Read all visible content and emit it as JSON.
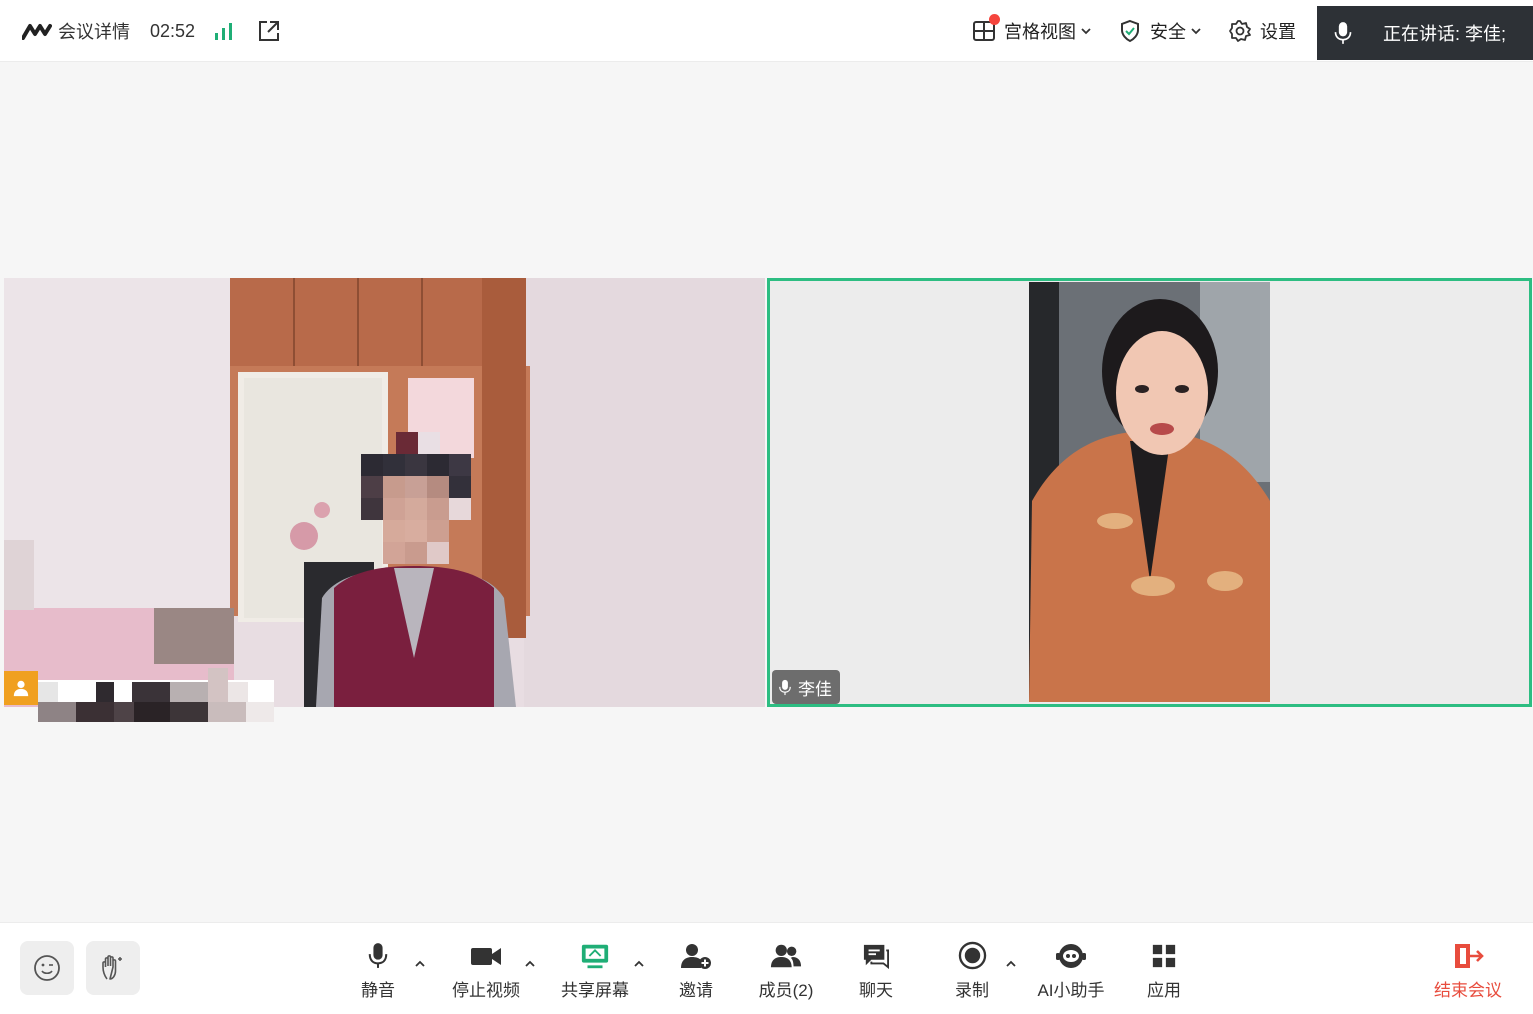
{
  "header": {
    "meeting_details_label": "会议详情",
    "timer": "02:52",
    "view_label": "宫格视图",
    "security_label": "安全",
    "settings_label": "设置",
    "speaking_label": "正在讲话:  李佳;"
  },
  "participants": [
    {
      "name": ""
    },
    {
      "name": "李佳"
    }
  ],
  "toolbar": {
    "mute_label": "静音",
    "stop_video_label": "停止视频",
    "share_screen_label": "共享屏幕",
    "invite_label": "邀请",
    "members_label": "成员(2)",
    "chat_label": "聊天",
    "record_label": "录制",
    "ai_assistant_label": "AI小助手",
    "apps_label": "应用",
    "end_meeting_label": "结束会议"
  },
  "colors": {
    "accent_green": "#2dbd82",
    "end_red": "#e84c3d",
    "signal_green": "#1fae76",
    "badge_orange": "#f0a020"
  }
}
